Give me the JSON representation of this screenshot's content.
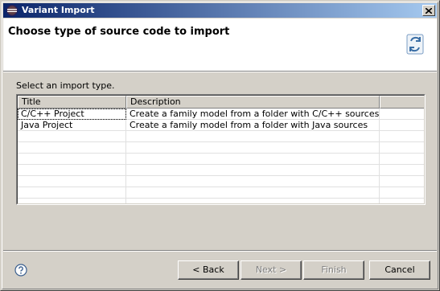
{
  "window": {
    "title": "Variant Import"
  },
  "header": {
    "title": "Choose type of source code to import"
  },
  "instruction": "Select an import type.",
  "table": {
    "columns": [
      "Title",
      "Description",
      ""
    ],
    "rows": [
      {
        "title": "C/C++ Project",
        "description": "Create a family model from a folder with C/C++ sources"
      },
      {
        "title": "Java Project",
        "description": "Create a family model from a folder with Java sources"
      }
    ]
  },
  "buttons": {
    "back": "< Back",
    "next": "Next >",
    "finish": "Finish",
    "cancel": "Cancel"
  },
  "icons": {
    "app": "eclipse-icon",
    "close": "close-icon",
    "wizard": "import-wizard-icon",
    "help": "help-icon"
  },
  "colors": {
    "titlebar_start": "#0a246a",
    "titlebar_end": "#a6caf0",
    "dialog_bg": "#d4d0c8"
  }
}
